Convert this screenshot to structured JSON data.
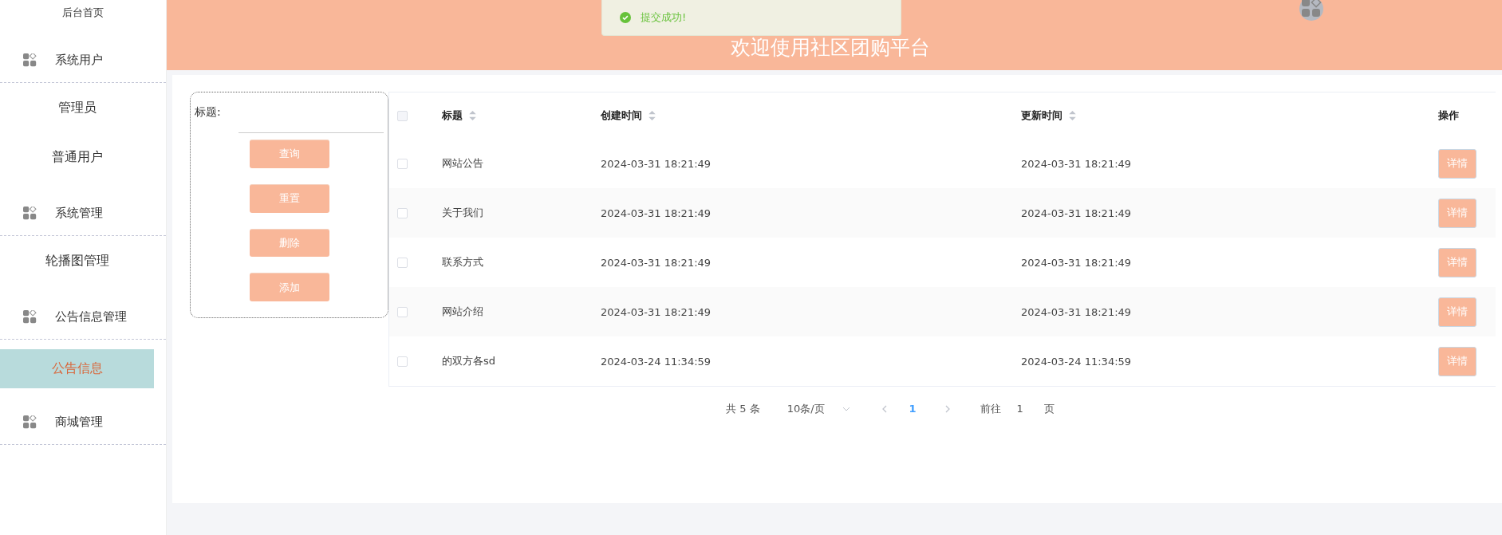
{
  "sidebar": {
    "items": [
      {
        "label": "后台首页",
        "kind": "link",
        "selected": false
      },
      {
        "label": "系统用户",
        "kind": "group",
        "children": [
          {
            "label": "管理员",
            "selected": false
          },
          {
            "label": "普通用户",
            "selected": false
          }
        ]
      },
      {
        "label": "系统管理",
        "kind": "group",
        "children": [
          {
            "label": "轮播图管理",
            "selected": false
          }
        ]
      },
      {
        "label": "公告信息管理",
        "kind": "group",
        "children": [
          {
            "label": "公告信息",
            "selected": true
          }
        ]
      },
      {
        "label": "商城管理",
        "kind": "group"
      }
    ]
  },
  "header": {
    "title": "欢迎使用社区团购平台"
  },
  "toast": {
    "kind": "success",
    "message": "提交成功!"
  },
  "filter": {
    "label": "标题:",
    "buttons": [
      "查询",
      "重置",
      "删除",
      "添加"
    ]
  },
  "table": {
    "select_all": {
      "checked": false
    },
    "columns": [
      {
        "label": "标题",
        "sortable": true
      },
      {
        "label": "创建时间",
        "sortable": true
      },
      {
        "label": "更新时间",
        "sortable": true
      },
      {
        "label": "操作",
        "sortable": false
      }
    ],
    "rows": [
      {
        "checked": false,
        "title": "网站公告",
        "created": "2024-03-31 18:21:49",
        "updated": "2024-03-31 18:21:49",
        "action": "详情"
      },
      {
        "checked": false,
        "title": "关于我们",
        "created": "2024-03-31 18:21:49",
        "updated": "2024-03-31 18:21:49",
        "action": "详情"
      },
      {
        "checked": false,
        "title": "联系方式",
        "created": "2024-03-31 18:21:49",
        "updated": "2024-03-31 18:21:49",
        "action": "详情"
      },
      {
        "checked": false,
        "title": "网站介绍",
        "created": "2024-03-31 18:21:49",
        "updated": "2024-03-31 18:21:49",
        "action": "详情"
      },
      {
        "checked": false,
        "title": "的双方各sd",
        "created": "2024-03-24 11:34:59",
        "updated": "2024-03-24 11:34:59",
        "action": "详情"
      }
    ]
  },
  "pagination": {
    "total": "共 5 条",
    "page_size": "10条/页",
    "pages": [
      {
        "label": "1",
        "selected": true
      }
    ],
    "goto_label": "前往",
    "goto_value": "1",
    "goto_unit": "页"
  }
}
